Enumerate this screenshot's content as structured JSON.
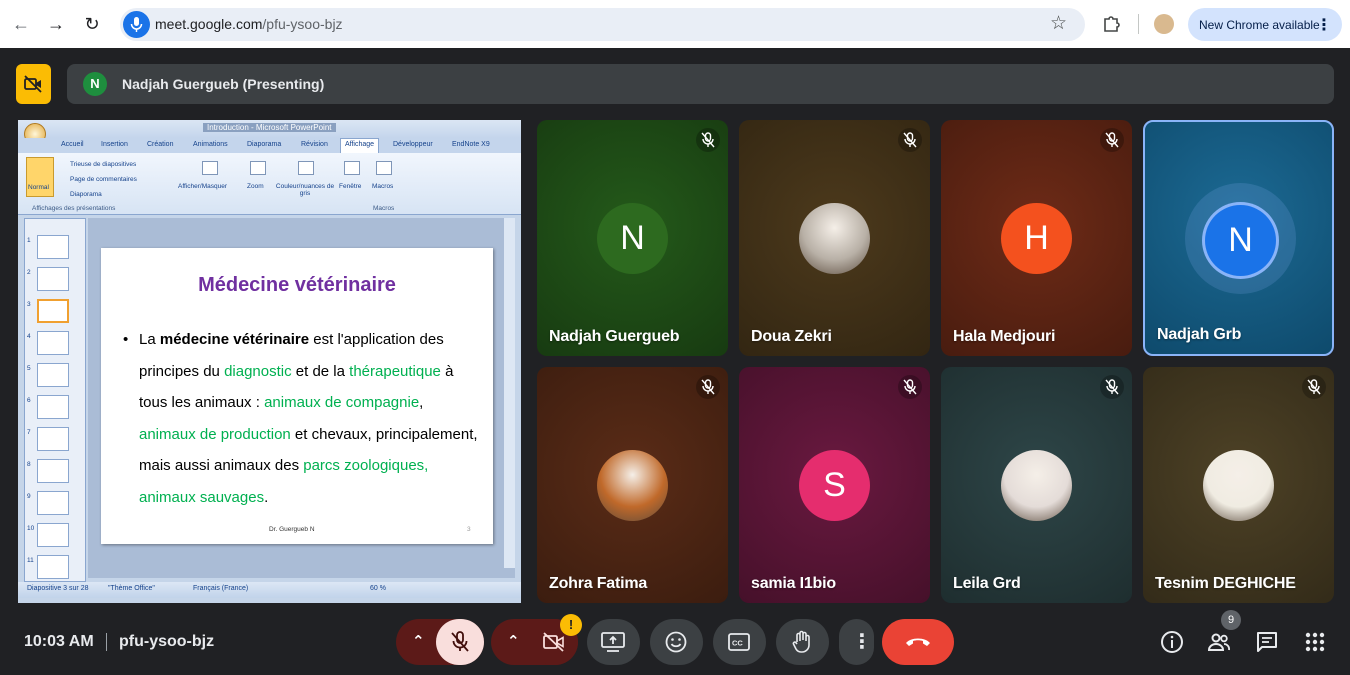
{
  "browser": {
    "url_host": "meet.google.com",
    "url_path": "/pfu-ysoo-bjz",
    "update_label": "New Chrome available"
  },
  "presenter": {
    "avatar_letter": "N",
    "label": "Nadjah Guergueb (Presenting)"
  },
  "powerpoint": {
    "window_title": "Introduction - Microsoft PowerPoint",
    "tabs": [
      "Accueil",
      "Insertion",
      "Création",
      "Animations",
      "Diaporama",
      "Révision",
      "Affichage",
      "Développeur",
      "EndNote X9"
    ],
    "active_tab": "Affichage",
    "ribbon": {
      "normal": "Normal",
      "trieuse": "Trieuse de diapositives",
      "commentaires": "Page de commentaires",
      "diaporama": "Diaporama",
      "group_affichages": "Affichages des présentations",
      "afficher_masquer": "Afficher/Masquer",
      "zoom": "Zoom",
      "couleur": "Couleur/nuances de gris",
      "fenetre": "Fenêtre",
      "macros": "Macros",
      "group_macros": "Macros"
    },
    "thumbnail_numbers": [
      "1",
      "2",
      "3",
      "4",
      "5",
      "6",
      "7",
      "8",
      "9",
      "10",
      "11"
    ],
    "selected_slide": 3,
    "status": {
      "slide_info": "Diapositive 3 sur 28",
      "theme": "\"Thème Office\"",
      "language": "Français (France)",
      "zoom": "60 %"
    },
    "slide": {
      "title": "Médecine vétérinaire",
      "bullet": "•",
      "body": {
        "p1": "La ",
        "p2_bold": "médecine vétérinaire",
        "p3": " est l'application des principes du ",
        "p4_green": "diagnostic",
        "p5": " et de la ",
        "p6_green": "thérapeutique",
        "p7": " à tous les animaux : ",
        "p8_green": "animaux de compagnie",
        "p9": ", ",
        "p10_green": "animaux de production",
        "p11": " et chevaux, principalement, mais aussi animaux des ",
        "p12_green": "parcs zoologiques, animaux sauvages",
        "p13": "."
      },
      "author": "Dr. Guergueb N",
      "page_number": "3"
    }
  },
  "participants": [
    {
      "name": "Nadjah Guergueb",
      "avatar": "N",
      "avatar_color": "#2d6a1f",
      "bg": "#245a1a",
      "mic": "muted"
    },
    {
      "name": "Doua Zekri",
      "avatar": "photo",
      "avatar_color": "#b8b0a6",
      "bg": "#4d3a1c",
      "mic": "muted"
    },
    {
      "name": "Hala Medjouri",
      "avatar": "H",
      "avatar_color": "#f4511e",
      "bg": "#6f2b17",
      "mic": "muted"
    },
    {
      "name": "Nadjah Grb",
      "avatar": "N",
      "avatar_color": "#1a73e8",
      "bg": "#0e4a6c",
      "mic": "active"
    },
    {
      "name": "Zohra Fatima",
      "avatar": "photo",
      "avatar_color": "#c0692a",
      "bg": "#5b2c17",
      "mic": "muted"
    },
    {
      "name": "samia I1bio",
      "avatar": "S",
      "avatar_color": "#e52d6e",
      "bg": "#6a1940",
      "mic": "muted"
    },
    {
      "name": "Leila Grd",
      "avatar": "photo",
      "avatar_color": "#e4dcd8",
      "bg": "#2e4648",
      "mic": "muted"
    },
    {
      "name": "Tesnim DEGHICHE",
      "avatar": "photo",
      "avatar_color": "#f0ece2",
      "bg": "#4e4226",
      "mic": "muted"
    }
  ],
  "bottom": {
    "time": "10:03 AM",
    "meeting_code": "pfu-ysoo-bjz",
    "people_count": "9"
  },
  "icons": {
    "back": "arrow-left-icon",
    "forward": "arrow-right-icon",
    "reload": "reload-icon",
    "mic": "mic-icon",
    "star": "star-icon",
    "extensions": "puzzle-icon",
    "menu": "more-vert-icon",
    "camera_off": "videocam-off-icon",
    "present": "present-screen-icon",
    "emoji": "emoji-icon",
    "captions": "closed-caption-icon",
    "hand": "raise-hand-icon",
    "leave": "call-end-icon",
    "info": "info-icon",
    "people": "people-icon",
    "chat": "chat-icon",
    "activities": "apps-grid-icon"
  }
}
